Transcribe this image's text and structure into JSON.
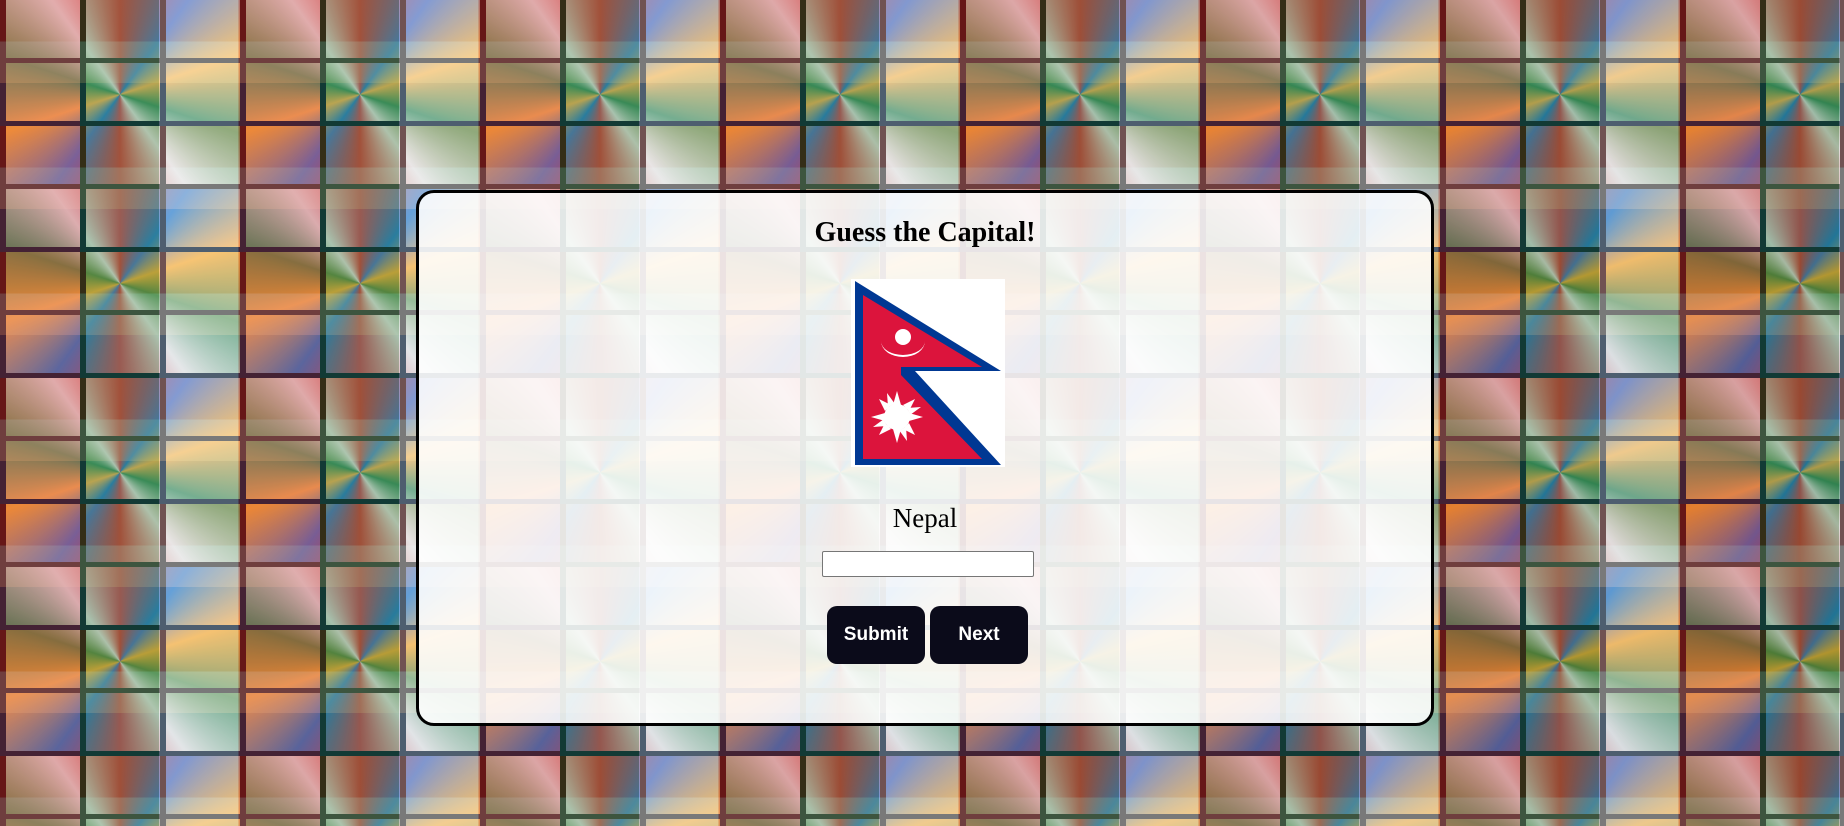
{
  "quiz": {
    "title": "Guess the Capital!",
    "country": "Nepal",
    "answer_value": "",
    "flag_icon": "nepal-flag"
  },
  "buttons": {
    "submit_label": "Submit",
    "next_label": "Next"
  },
  "colors": {
    "button_bg": "#0b0b1a",
    "flag_red": "#dc143c",
    "flag_blue": "#003893"
  }
}
